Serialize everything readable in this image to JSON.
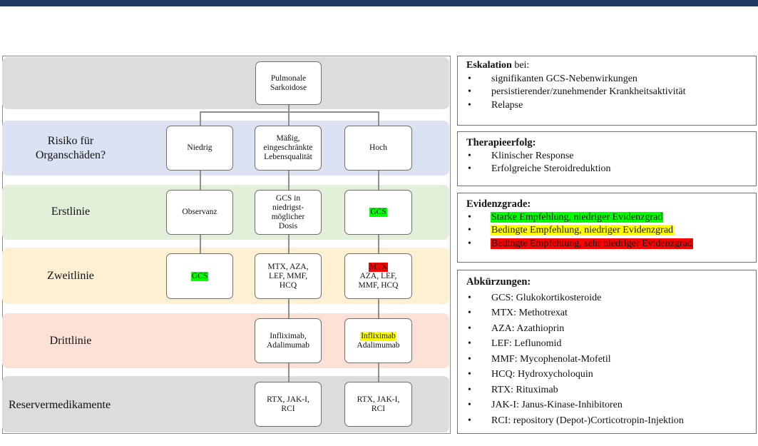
{
  "colors": {
    "top_bar": "#1f3864",
    "band_root": "#dcdcdc",
    "band_risk": "#dbe3f2",
    "band_first": "#e2efd9",
    "band_second": "#fdf0d2",
    "band_third": "#fbe1d5",
    "band_reserve": "#dcdcdc",
    "green": "#00ff00",
    "yellow": "#ffff00",
    "red": "#ff0000"
  },
  "flowchart": {
    "root": "Pulmonale\nSarkoidose",
    "rows": [
      {
        "label": "Risiko für\nOrganschäden?",
        "nodes": [
          {
            "text": "Niedrig"
          },
          {
            "text": "Mäßig,\neingeschränkte\nLebensqualität"
          },
          {
            "text": "Hoch"
          }
        ]
      },
      {
        "label": "Erstlinie",
        "nodes": [
          {
            "text": "Observanz"
          },
          {
            "text": "GCS in\nniedrigst-\nmöglicher\nDosis"
          },
          {
            "text": "GCS",
            "highlight": "green"
          }
        ]
      },
      {
        "label": "Zweitlinie",
        "nodes": [
          {
            "text": "GCS",
            "highlight": "green"
          },
          {
            "text": "MTX, AZA,\nLEF, MMF,\nHCQ"
          },
          {
            "text": "MTX",
            "highlight": "red",
            "rest": "AZA, LEF,\nMMF, HCQ"
          }
        ]
      },
      {
        "label": "Drittlinie",
        "nodes": [
          {
            "text": "Infliximab,\nAdalimumab"
          },
          {
            "text": "Infliximab",
            "highlight": "yellow",
            "rest": "Adalimumab"
          }
        ]
      },
      {
        "label": "Reservermedikamente",
        "nodes": [
          {
            "text": "RTX, JAK-I,\nRCI"
          },
          {
            "text": "RTX, JAK-I,\nRCI"
          }
        ]
      }
    ]
  },
  "panels": {
    "escalation": {
      "title_bold": "Eskalation",
      "title_rest": " bei:",
      "items": [
        "signifikanten GCS-Nebenwirkungen",
        "persistierender/zunehmender Krankheitsaktivität",
        "Relapse"
      ]
    },
    "success": {
      "title": "Therapieerfolg:",
      "items": [
        "Klinischer Response",
        "Erfolgreiche Steroidreduktion"
      ]
    },
    "evidence": {
      "title": "Evidenzgrade:",
      "items": [
        {
          "text": "Starke Empfehlung, niedriger Evidenzgrad",
          "color": "green"
        },
        {
          "text": "Bedingte Empfehlung, niedriger Evidenzgrad",
          "color": "yellow"
        },
        {
          "text": "Bedingte Empfehlung, sehr niedriger Evidenzgrad",
          "color": "red"
        }
      ]
    },
    "abbreviations": {
      "title": "Abkürzungen:",
      "items": [
        "GCS: Glukokortikosteroide",
        "MTX: Methotrexat",
        "AZA: Azathioprin",
        "LEF: Leflunomid",
        "MMF: Mycophenolat-Mofetil",
        "HCQ: Hydroxycholoquin",
        "RTX: Rituximab",
        "JAK-I: Janus-Kinase-Inhibitoren",
        "RCI: repository (Depot-)Corticotropin-Injektion"
      ]
    }
  }
}
